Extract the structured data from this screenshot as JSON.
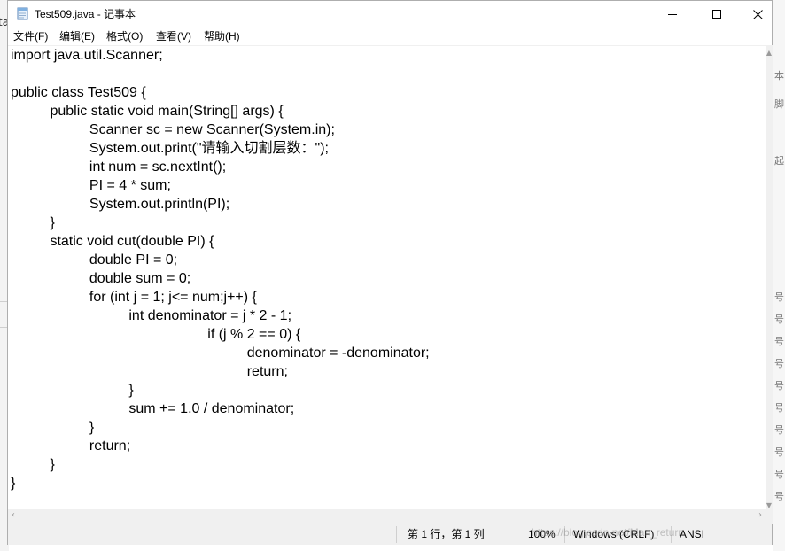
{
  "window": {
    "title": "Test509.java - 记事本",
    "controls": {
      "minimize": "─",
      "maximize": "☐",
      "close": "✕"
    }
  },
  "menu": {
    "items": [
      {
        "label": "文件(F)"
      },
      {
        "label": "编辑(E)"
      },
      {
        "label": "格式(O)"
      },
      {
        "label": "查看(V)"
      },
      {
        "label": "帮助(H)"
      }
    ]
  },
  "editor": {
    "lines": [
      "import java.util.Scanner;",
      "",
      "public class Test509 {",
      "\tpublic static void main(String[] args) {",
      "\t\tScanner sc = new Scanner(System.in);",
      "\t\tSystem.out.print(\"请输入切割层数：\");",
      "\t\tint num = sc.nextInt();",
      "\t\tPI = 4 * sum;",
      "\t\tSystem.out.println(PI);",
      "\t}",
      "\tstatic void cut(double PI) {",
      "\t\tdouble PI = 0;",
      "\t\tdouble sum = 0;",
      "\t\tfor (int j = 1; j<= num;j++) {",
      "\t\t\tint denominator = j * 2 - 1;",
      "\t\t\t\t\tif (j % 2 == 0) {",
      "\t\t\t\t\t\tdenominator = -denominator;",
      "\t\t\t\t\t\treturn;",
      "\t\t\t}",
      "\t\t\tsum += 1.0 / denominator;",
      "\t\t}",
      "\t\treturn;",
      "\t}",
      "}"
    ]
  },
  "statusbar": {
    "position": "第 1 行，第 1 列",
    "zoom": "100%",
    "line_ending": "Windows (CRLF)",
    "encoding": "ANSI"
  },
  "watermark": "https://blog.csdn.net/Man_return",
  "background": {
    "left_char": "ta",
    "right_marks": [
      "本",
      "脚",
      "起",
      "号",
      "号",
      "号",
      "号",
      "号",
      "号",
      "号",
      "号",
      "号",
      "号"
    ]
  },
  "colors": {
    "titlebar_bg": "#ffffff",
    "statusbar_bg": "#f0f0f0",
    "border": "#aeaeae",
    "text": "#000000"
  },
  "icons": {
    "app": "notepad-icon",
    "minimize": "minimize-icon",
    "maximize": "maximize-icon",
    "close": "close-icon"
  }
}
